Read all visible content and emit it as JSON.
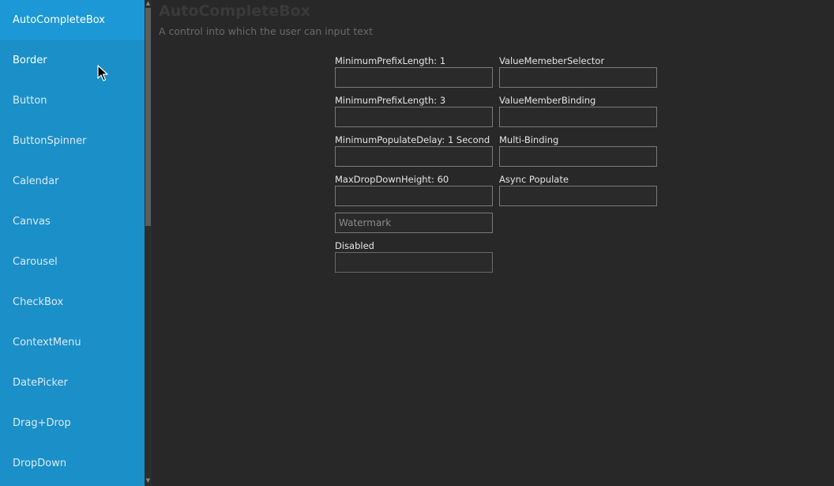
{
  "sidebar": {
    "items": [
      {
        "label": "AutoCompleteBox"
      },
      {
        "label": "Border"
      },
      {
        "label": "Button"
      },
      {
        "label": "ButtonSpinner"
      },
      {
        "label": "Calendar"
      },
      {
        "label": "Canvas"
      },
      {
        "label": "Carousel"
      },
      {
        "label": "CheckBox"
      },
      {
        "label": "ContextMenu"
      },
      {
        "label": "DatePicker"
      },
      {
        "label": "Drag+Drop"
      },
      {
        "label": "DropDown"
      }
    ],
    "selected_index": 0,
    "hovered_index": 1
  },
  "page": {
    "title": "AutoCompleteBox",
    "subtitle": "A control into which the user can input text"
  },
  "fields": {
    "prefix1": {
      "label": "MinimumPrefixLength: 1",
      "value": ""
    },
    "prefix3": {
      "label": "MinimumPrefixLength: 3",
      "value": ""
    },
    "delay": {
      "label": "MinimumPopulateDelay: 1 Second",
      "value": ""
    },
    "maxdrop": {
      "label": "MaxDropDownHeight: 60",
      "value": ""
    },
    "watermark": {
      "placeholder": "Watermark",
      "value": ""
    },
    "disabled": {
      "label": "Disabled",
      "value": ""
    },
    "selector": {
      "label": "ValueMemeberSelector",
      "value": ""
    },
    "binding": {
      "label": "ValueMemberBinding",
      "value": ""
    },
    "multi": {
      "label": "Multi-Binding",
      "value": ""
    },
    "async": {
      "label": "Async Populate",
      "value": ""
    }
  },
  "colors": {
    "sidebar": "#1a8fc8",
    "sidebar_selected": "#1c98d6",
    "background": "#282828",
    "input_border": "#7a7a7a"
  }
}
